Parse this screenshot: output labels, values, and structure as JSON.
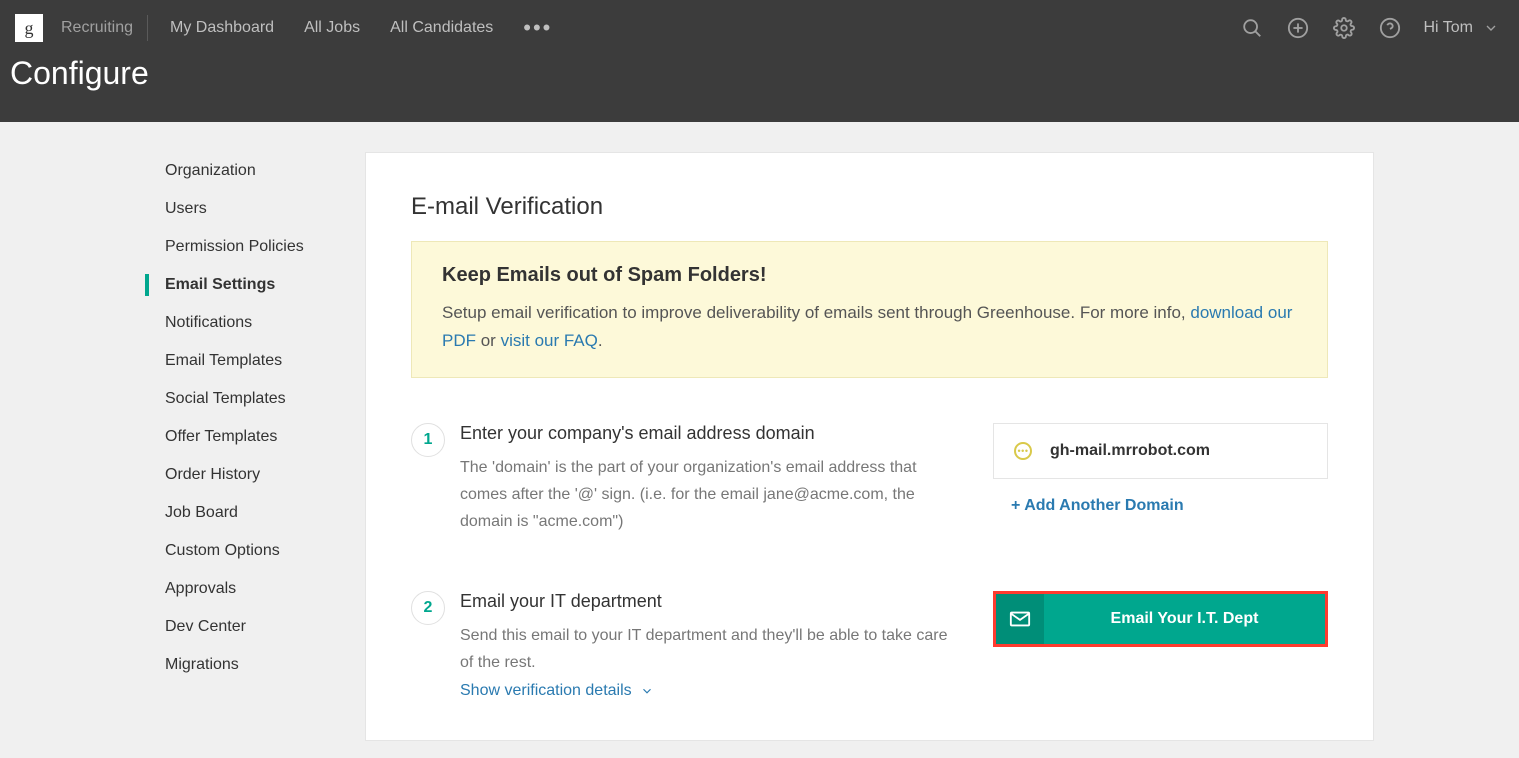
{
  "topbar": {
    "product": "Recruiting",
    "nav": [
      "My Dashboard",
      "All Jobs",
      "All Candidates"
    ],
    "greeting": "Hi Tom"
  },
  "page": {
    "title": "Configure"
  },
  "sidebar": {
    "items": [
      "Organization",
      "Users",
      "Permission Policies",
      "Email Settings",
      "Notifications",
      "Email Templates",
      "Social Templates",
      "Offer Templates",
      "Order History",
      "Job Board",
      "Custom Options",
      "Approvals",
      "Dev Center",
      "Migrations"
    ],
    "active_index": 3
  },
  "panel": {
    "title": "E-mail Verification",
    "alert": {
      "heading": "Keep Emails out of Spam Folders!",
      "text_prefix": "Setup email verification to improve deliverability of emails sent through Greenhouse. For more info, ",
      "link1": "download our PDF",
      "joiner": " or ",
      "link2": "visit our FAQ",
      "suffix": "."
    },
    "steps": [
      {
        "num": "1",
        "title": "Enter your company's email address domain",
        "desc": "The 'domain' is the part of your organization's email address that comes after the '@' sign. (i.e. for the email jane@acme.com, the domain is \"acme.com\")"
      },
      {
        "num": "2",
        "title": "Email your IT department",
        "desc": "Send this email to your IT department and they'll be able to take care of the rest.",
        "detail_link": "Show verification details"
      }
    ],
    "domain": {
      "name": "gh-mail.mrrobot.com",
      "add_label": "+ Add Another Domain"
    },
    "cta_label": "Email Your I.T. Dept"
  }
}
